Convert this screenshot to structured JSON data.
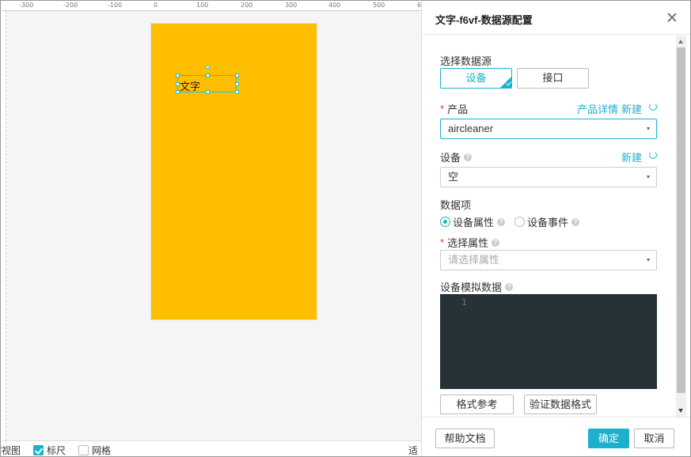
{
  "ruler": {
    "ticks": [
      "-300",
      "-200",
      "-100",
      "0",
      "100",
      "200",
      "300",
      "400",
      "500",
      "6"
    ]
  },
  "canvas": {
    "widget_text": "文字"
  },
  "bottom_bar": {
    "thumbnail_label": "缩视图",
    "ruler_label": "标尺",
    "ruler_checked": true,
    "grid_label": "网格",
    "grid_checked": false,
    "fit_label": "适合"
  },
  "panel": {
    "title": "文字-f6vf-数据源配置",
    "datasource": {
      "label": "选择数据源",
      "options": [
        "设备",
        "接口"
      ],
      "selected": "设备"
    },
    "product": {
      "label": "产品",
      "required": true,
      "detail_link": "产品详情",
      "new_link": "新建",
      "value": "aircleaner"
    },
    "device": {
      "label": "设备",
      "new_link": "新建",
      "value": "空"
    },
    "data_item": {
      "label": "数据项",
      "options": [
        "设备属性",
        "设备事件"
      ],
      "selected": "设备属性"
    },
    "attribute": {
      "label": "选择属性",
      "required": true,
      "placeholder": "请选择属性"
    },
    "mock_data": {
      "label": "设备模拟数据",
      "line_number": "1"
    },
    "format_ref_button": "格式参考",
    "validate_button": "验证数据格式",
    "footer": {
      "help_button": "帮助文档",
      "ok_button": "确定",
      "cancel_button": "取消"
    }
  },
  "colors": {
    "accent": "#1bb1cc",
    "canvas_page": "#ffbe00",
    "editor_bg": "#263238",
    "required": "#e53935"
  }
}
